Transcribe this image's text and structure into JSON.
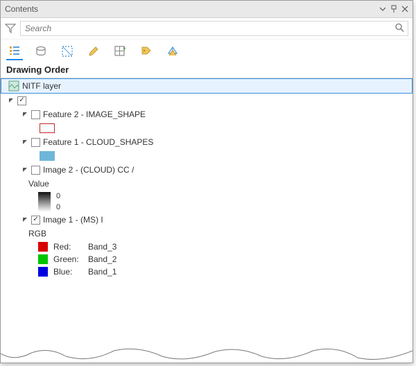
{
  "pane": {
    "title": "Contents"
  },
  "search": {
    "placeholder": "Search"
  },
  "section": {
    "header": "Drawing Order"
  },
  "tree": {
    "root": {
      "label": "NITF layer"
    },
    "group": {
      "label_blurred": "                                                "
    },
    "feature2": {
      "label": "Feature 2 - IMAGE_SHAPE"
    },
    "feature1": {
      "label": "Feature 1 - CLOUD_SHAPES"
    },
    "image2": {
      "label": "Image 2 - (CLOUD) CC / ",
      "value_label": "Value",
      "high": "0",
      "low": "0"
    },
    "image1": {
      "label": "Image 1 - (MS) I",
      "rgb_label": "RGB"
    },
    "rgb": {
      "red": {
        "band_label": "Red:",
        "band": "Band_3"
      },
      "green": {
        "band_label": "Green:",
        "band": "Band_2"
      },
      "blue": {
        "band_label": "Blue:",
        "band": "Band_1"
      }
    },
    "followup_blurred": "                                  "
  },
  "icons": {
    "funnel": "funnel-icon",
    "search": "search-icon",
    "draw_order": "list-by-drawing-order-icon",
    "data_source": "list-by-data-source-icon",
    "selection": "list-by-selection-icon",
    "editing": "list-by-editing-icon",
    "snapping": "list-by-snapping-icon",
    "labeling": "list-by-labeling-icon",
    "perspective": "list-by-perspective-icon",
    "dropdown": "dropdown-icon",
    "pin": "auto-hide-icon",
    "close": "close-icon"
  }
}
